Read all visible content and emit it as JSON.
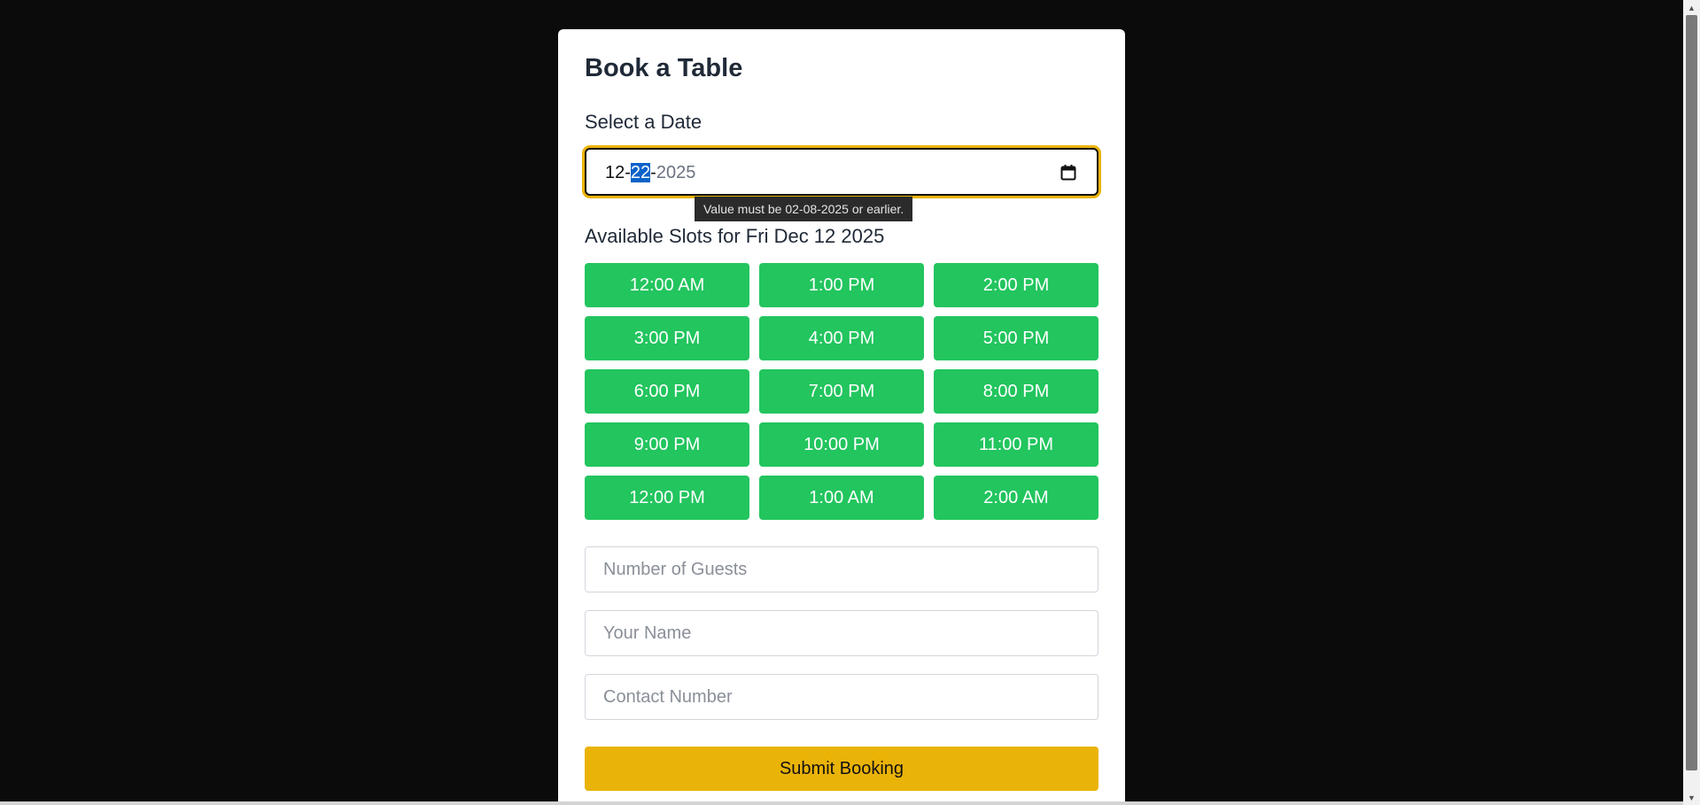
{
  "booking": {
    "title": "Book a Table",
    "date_label": "Select a Date",
    "date_input": {
      "month": "12",
      "separator": "-",
      "day": "22",
      "year": "2025"
    },
    "tooltip": "Value must be 02-08-2025 or earlier.",
    "slots_heading": "Available Slots for Fri Dec 12 2025",
    "slots": [
      "12:00 AM",
      "1:00 PM",
      "2:00 PM",
      "3:00 PM",
      "4:00 PM",
      "5:00 PM",
      "6:00 PM",
      "7:00 PM",
      "8:00 PM",
      "9:00 PM",
      "10:00 PM",
      "11:00 PM",
      "12:00 PM",
      "1:00 AM",
      "2:00 AM"
    ],
    "guests_placeholder": "Number of Guests",
    "name_placeholder": "Your Name",
    "contact_placeholder": "Contact Number",
    "submit_label": "Submit Booking"
  },
  "icons": {
    "calendar": "calendar-icon",
    "scroll_up": "scroll-up-arrow-icon",
    "scroll_down": "scroll-down-arrow-icon"
  },
  "colors": {
    "page_background": "#0b0b0b",
    "slot_green": "#22c55e",
    "accent_yellow": "#eab308",
    "selection_blue": "#0a63c9",
    "text_dark": "#1f2937"
  }
}
